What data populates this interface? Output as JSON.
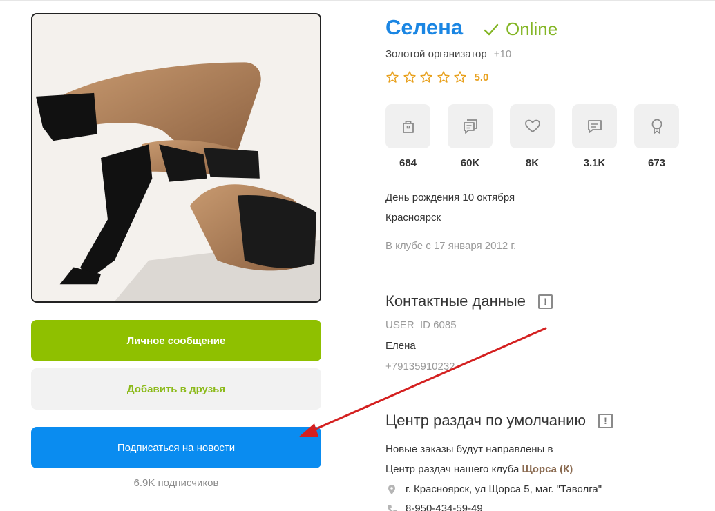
{
  "profile": {
    "name": "Селена",
    "status": "Online",
    "role": "Золотой организатор",
    "role_plus": "+10",
    "rating": "5.0",
    "rating_stars": 5
  },
  "actions": {
    "message": "Личное сообщение",
    "add_friend": "Добавить в друзья",
    "subscribe": "Подписаться на новости",
    "subscribers": "6.9K подписчиков"
  },
  "stats": [
    {
      "icon": "bag-icon",
      "value": "684"
    },
    {
      "icon": "comments-icon",
      "value": "60K"
    },
    {
      "icon": "heart-icon",
      "value": "8K"
    },
    {
      "icon": "message-icon",
      "value": "3.1K"
    },
    {
      "icon": "award-icon",
      "value": "673"
    }
  ],
  "info": {
    "birthday": "День рождения 10 октября",
    "city": "Красноярск",
    "member_since": "В клубе с 17 января 2012 г."
  },
  "contacts": {
    "title": "Контактные данные",
    "user_id": "USER_ID 6085",
    "name": "Елена",
    "phone": "+79135910232"
  },
  "pickup": {
    "title": "Центр раздач по умолчанию",
    "line1": "Новые заказы будут направлены в",
    "line2_prefix": "Центр раздач нашего клуба ",
    "line2_link": "Щорса (К)",
    "address": "г. Красноярск, ул Щорса 5, маг. \"Таволга\"",
    "phone": "8-950-434-59-49"
  },
  "colors": {
    "name": "#1b86e3",
    "online": "#83b524",
    "message_button": "#8fc000",
    "subscribe_button": "#0a8cf0",
    "star": "#e8a01c",
    "annotation_arrow": "#d42020"
  }
}
